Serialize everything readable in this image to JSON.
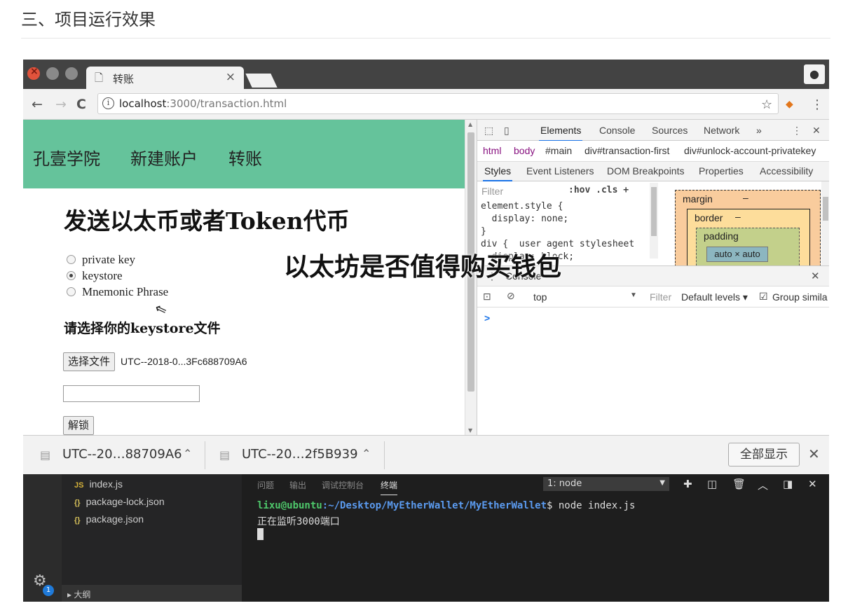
{
  "article": {
    "heading": "三、项目运行效果"
  },
  "browser": {
    "tab_title": "转账",
    "url_host": "localhost",
    "url_rest": ":3000/transaction.html"
  },
  "page": {
    "nav": [
      "孔壹学院",
      "新建账户",
      "转账"
    ],
    "title": "发送以太币或者Token代币",
    "radios": [
      {
        "label": "private key",
        "checked": false
      },
      {
        "label": "keystore",
        "checked": true
      },
      {
        "label": "Mnemonic Phrase",
        "checked": false
      }
    ],
    "keystore_label": "请选择你的keystore文件",
    "file_button": "选择文件",
    "file_name": "UTC--2018-0...3Fc688709A6",
    "password_value": "",
    "unlock_button": "解锁"
  },
  "devtools": {
    "tabs": [
      "Elements",
      "Console",
      "Sources",
      "Network",
      "»"
    ],
    "breadcrumbs": [
      "html",
      "body",
      "#main",
      "div#transaction-first",
      "div#unlock-account-privatekey"
    ],
    "subtabs": [
      "Styles",
      "Event Listeners",
      "DOM Breakpoints",
      "Properties",
      "Accessibility"
    ],
    "filter_placeholder": "Filter",
    "hov_cls": ":hov  .cls  +",
    "code_lines": [
      "element.style {",
      "  display: none;",
      "}",
      "div {  user agent stylesheet",
      "  display: block;"
    ],
    "box_model": {
      "margin": "margin",
      "border": "border",
      "padding": "padding",
      "content": "auto × auto",
      "dash": "–"
    },
    "drawer_title": "Console",
    "console": {
      "context": "top",
      "filter": "Filter",
      "levels": "Default levels ▾",
      "group": "Group simila"
    },
    "prompt": ">"
  },
  "downloads": {
    "items": [
      "UTC--20…88709A6",
      "UTC--20…2f5B939"
    ],
    "show_all": "全部显示"
  },
  "vscode": {
    "files": [
      {
        "icon": "JS",
        "name": "index.js"
      },
      {
        "icon": "{}",
        "name": "package-lock.json"
      },
      {
        "icon": "{}",
        "name": "package.json"
      }
    ],
    "outline": "▸ 大纲",
    "badge": "1",
    "panel_tabs": [
      "问题",
      "输出",
      "调试控制台",
      "终端"
    ],
    "terminal_select": "1: node",
    "term_user": "lixu@ubuntu",
    "term_path": ":~/Desktop/MyEtherWallet/MyEtherWallet",
    "term_cmd": "$ node index.js",
    "term_output": "正在监听3000端口"
  },
  "watermark": "以太坊是否值得购买钱包"
}
